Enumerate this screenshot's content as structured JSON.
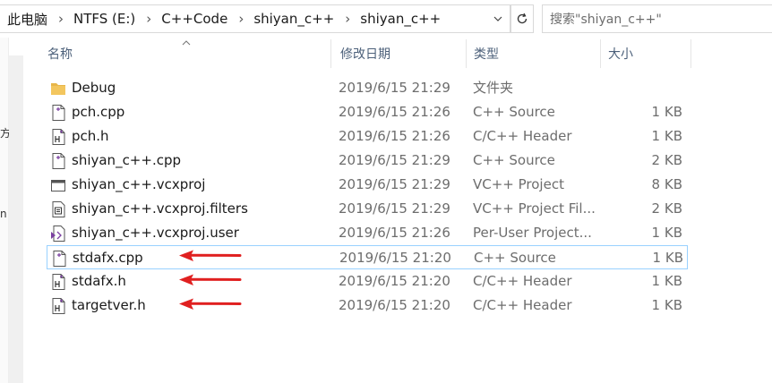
{
  "breadcrumb": [
    "此电脑",
    "NTFS (E:)",
    "C++Code",
    "shiyan_c++",
    "shiyan_c++"
  ],
  "search": {
    "placeholder": "搜索\"shiyan_c++\""
  },
  "columns": {
    "name": "名称",
    "modified": "修改日期",
    "type": "类型",
    "size": "大小"
  },
  "nav_fragments": [
    "方",
    "n"
  ],
  "files": [
    {
      "icon": "folder-icon",
      "name": "Debug",
      "modified": "2019/6/15 21:29",
      "type": "文件夹",
      "size": "",
      "selected": false,
      "arrow": false
    },
    {
      "icon": "cpp-file-icon",
      "name": "pch.cpp",
      "modified": "2019/6/15 21:26",
      "type": "C++ Source",
      "size": "1 KB",
      "selected": false,
      "arrow": false
    },
    {
      "icon": "header-file-icon",
      "name": "pch.h",
      "modified": "2019/6/15 21:26",
      "type": "C/C++ Header",
      "size": "1 KB",
      "selected": false,
      "arrow": false
    },
    {
      "icon": "cpp-file-icon",
      "name": "shiyan_c++.cpp",
      "modified": "2019/6/15 21:29",
      "type": "C++ Source",
      "size": "2 KB",
      "selected": false,
      "arrow": false
    },
    {
      "icon": "vcxproj-file-icon",
      "name": "shiyan_c++.vcxproj",
      "modified": "2019/6/15 21:29",
      "type": "VC++ Project",
      "size": "8 KB",
      "selected": false,
      "arrow": false
    },
    {
      "icon": "filters-file-icon",
      "name": "shiyan_c++.vcxproj.filters",
      "modified": "2019/6/15 21:29",
      "type": "VC++ Project Fil...",
      "size": "2 KB",
      "selected": false,
      "arrow": false
    },
    {
      "icon": "user-file-icon",
      "name": "shiyan_c++.vcxproj.user",
      "modified": "2019/6/15 21:26",
      "type": "Per-User Project...",
      "size": "1 KB",
      "selected": false,
      "arrow": false
    },
    {
      "icon": "cpp-file-icon",
      "name": "stdafx.cpp",
      "modified": "2019/6/15 21:20",
      "type": "C++ Source",
      "size": "1 KB",
      "selected": true,
      "arrow": true
    },
    {
      "icon": "header-file-icon",
      "name": "stdafx.h",
      "modified": "2019/6/15 21:20",
      "type": "C/C++ Header",
      "size": "1 KB",
      "selected": false,
      "arrow": true
    },
    {
      "icon": "header-file-icon",
      "name": "targetver.h",
      "modified": "2019/6/15 21:20",
      "type": "C/C++ Header",
      "size": "1 KB",
      "selected": false,
      "arrow": true
    }
  ],
  "colors": {
    "selection_border": "#99d1ff",
    "arrow": "#e02020",
    "header_text": "#4c607a",
    "folder": "#e8b64a"
  }
}
